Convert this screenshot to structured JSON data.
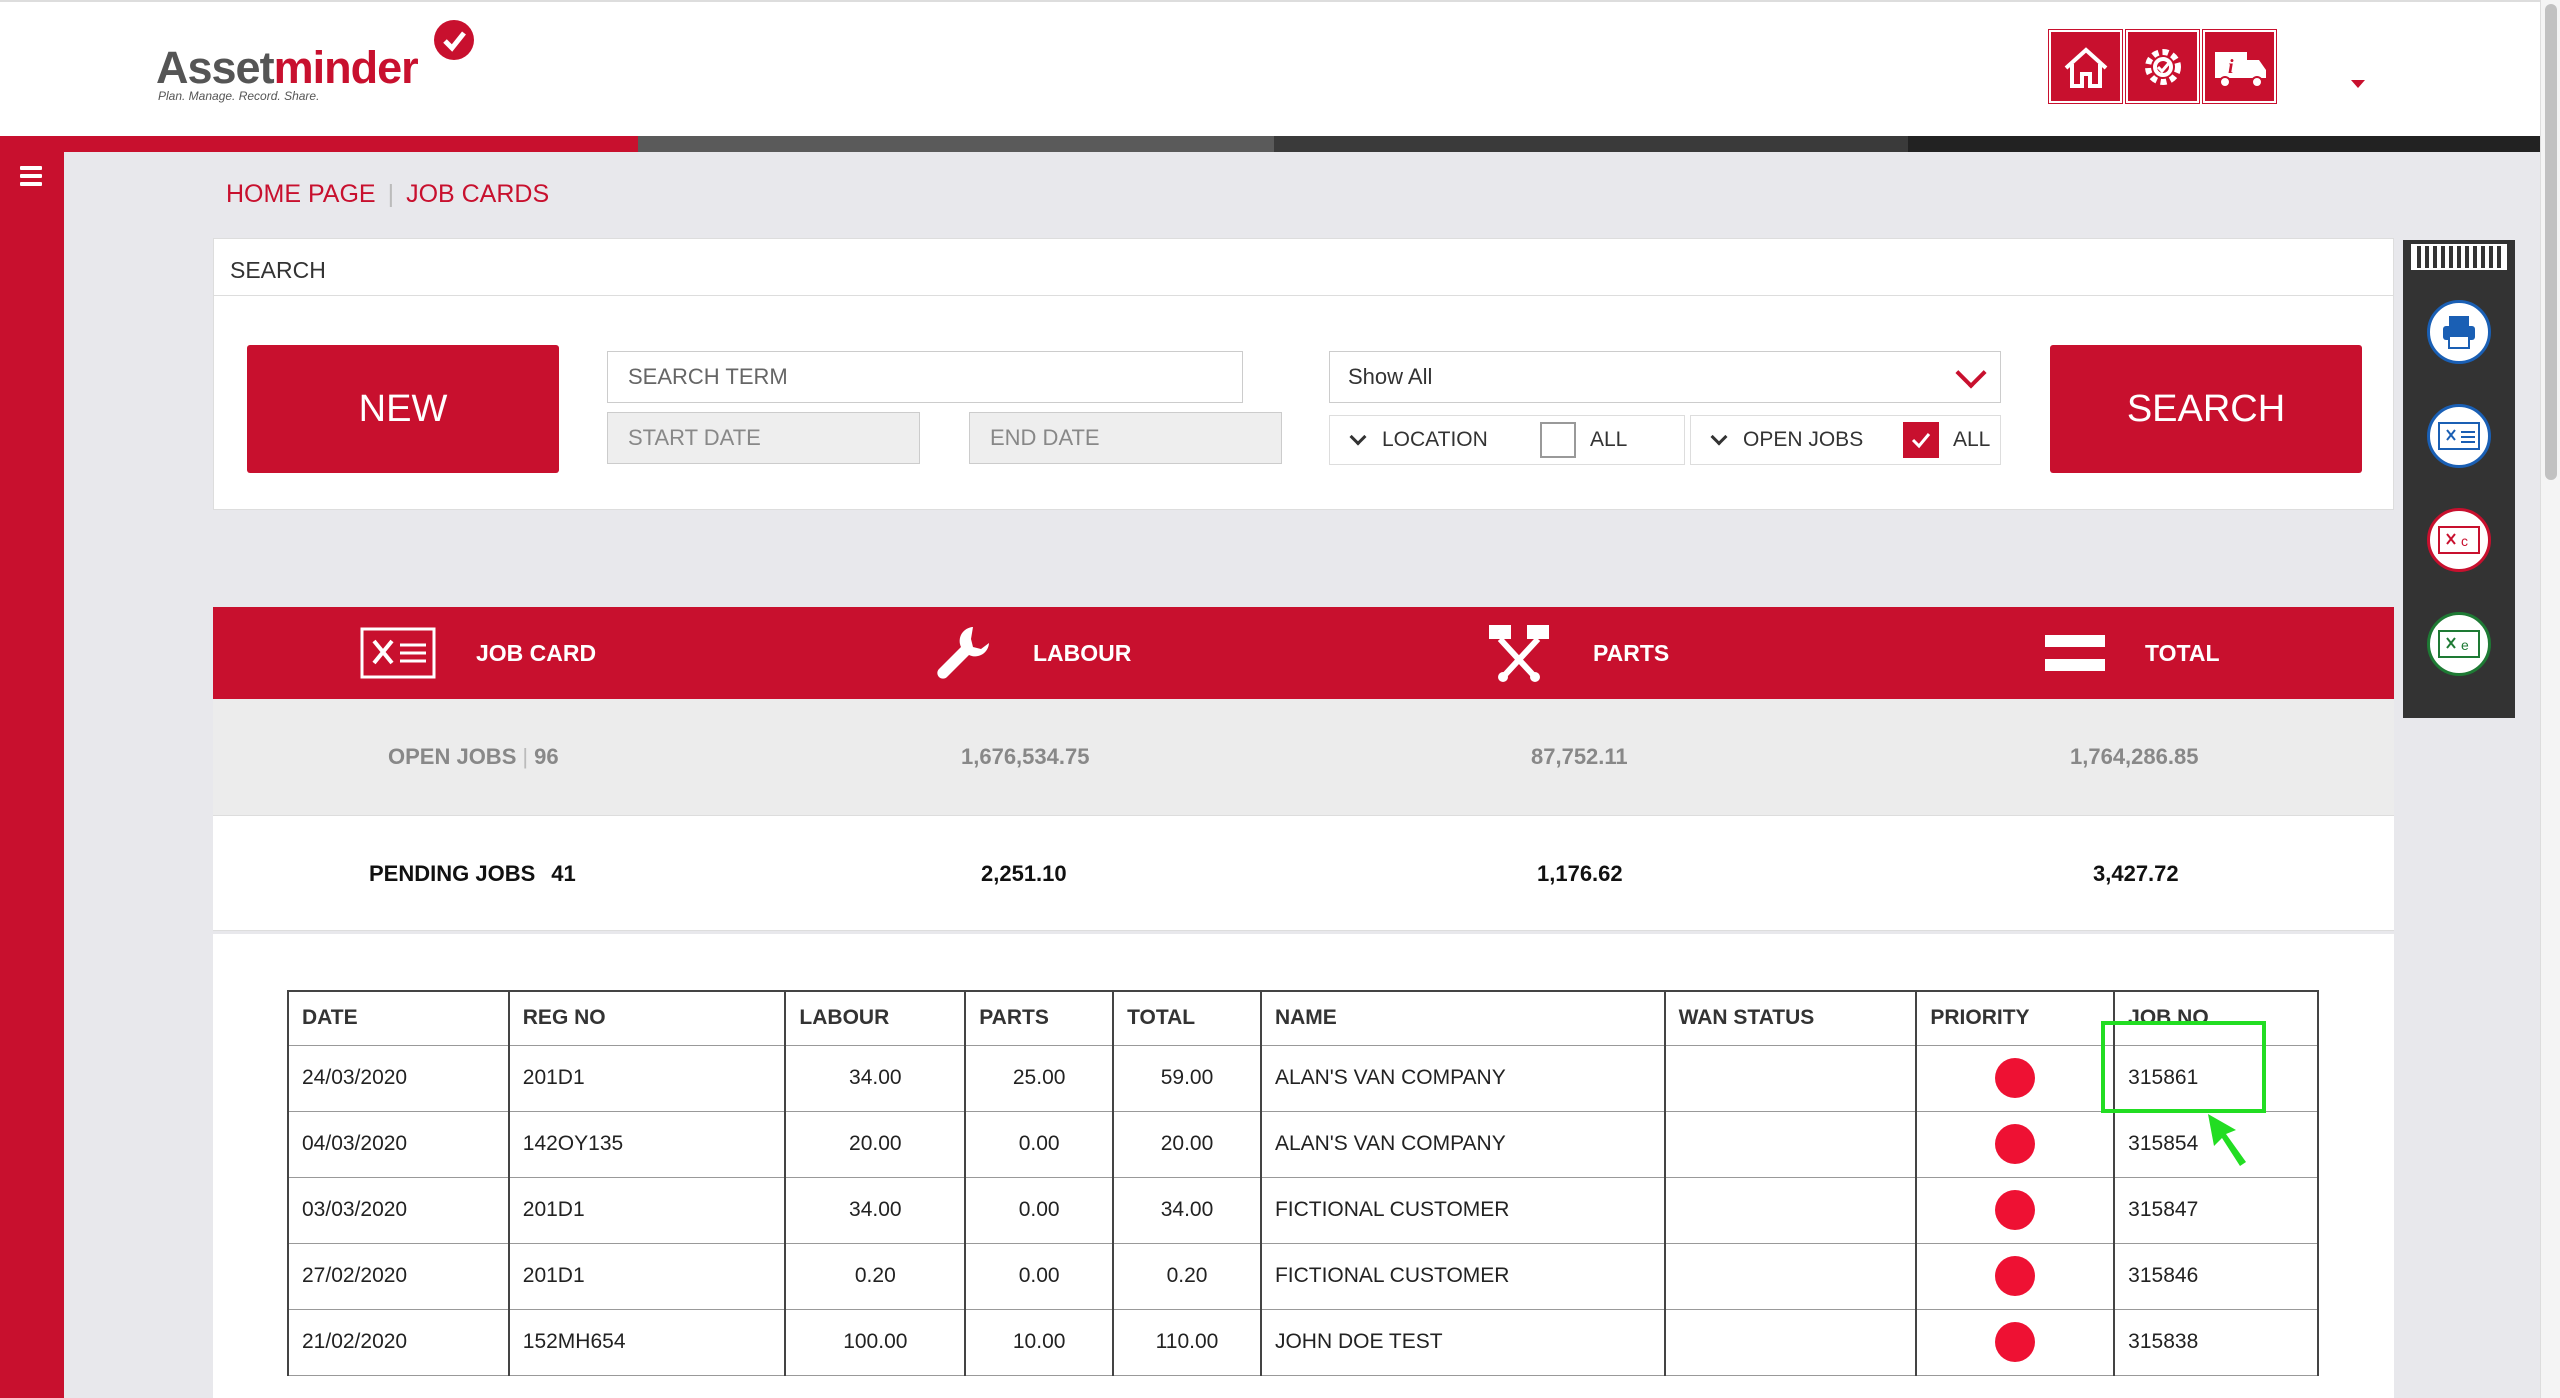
{
  "brand": {
    "name_part1": "Asset",
    "name_part2": "minder",
    "tagline": "Plan. Manage. Record. Share."
  },
  "header": {
    "icons": [
      "home-icon",
      "settings-gear-icon",
      "van-info-icon"
    ],
    "user_menu": "caret-down-icon"
  },
  "breadcrumb": {
    "home": "HOME PAGE",
    "current": "JOB CARDS"
  },
  "search": {
    "title": "SEARCH",
    "new_label": "NEW",
    "search_term_placeholder": "SEARCH TERM",
    "start_date_placeholder": "START DATE",
    "end_date_placeholder": "END DATE",
    "show_select": "Show All",
    "location_label": "LOCATION",
    "location_all_label": "ALL",
    "location_all_checked": false,
    "open_jobs_label": "OPEN JOBS",
    "open_jobs_all_label": "ALL",
    "open_jobs_all_checked": true,
    "search_label": "SEARCH"
  },
  "side_tools": [
    "barcode-icon",
    "print-icon",
    "export-icon",
    "export-csv-icon",
    "export-excel-icon"
  ],
  "summary": {
    "headers": {
      "job_card": "JOB CARD",
      "labour": "LABOUR",
      "parts": "PARTS",
      "total": "TOTAL"
    },
    "open": {
      "label": "OPEN JOBS",
      "count": "96",
      "labour": "1,676,534.75",
      "parts": "87,752.11",
      "total": "1,764,286.85"
    },
    "pending": {
      "label": "PENDING JOBS",
      "count": "41",
      "labour": "2,251.10",
      "parts": "1,176.62",
      "total": "3,427.72"
    }
  },
  "table": {
    "columns": [
      "DATE",
      "REG NO",
      "LABOUR",
      "PARTS",
      "TOTAL",
      "NAME",
      "WAN STATUS",
      "PRIORITY",
      "JOB NO"
    ],
    "rows": [
      {
        "date": "24/03/2020",
        "reg": "201D1",
        "labour": "34.00",
        "parts": "25.00",
        "total": "59.00",
        "name": "ALAN'S VAN COMPANY",
        "wan": "",
        "priority": "#ee1133",
        "job": "315861"
      },
      {
        "date": "04/03/2020",
        "reg": "142OY135",
        "labour": "20.00",
        "parts": "0.00",
        "total": "20.00",
        "name": "ALAN'S VAN COMPANY",
        "wan": "",
        "priority": "#ee1133",
        "job": "315854"
      },
      {
        "date": "03/03/2020",
        "reg": "201D1",
        "labour": "34.00",
        "parts": "0.00",
        "total": "34.00",
        "name": "FICTIONAL CUSTOMER",
        "wan": "",
        "priority": "#ee1133",
        "job": "315847"
      },
      {
        "date": "27/02/2020",
        "reg": "201D1",
        "labour": "0.20",
        "parts": "0.00",
        "total": "0.20",
        "name": "FICTIONAL CUSTOMER",
        "wan": "",
        "priority": "#ee1133",
        "job": "315846"
      },
      {
        "date": "21/02/2020",
        "reg": "152MH654",
        "labour": "100.00",
        "parts": "10.00",
        "total": "110.00",
        "name": "JOHN DOE TEST",
        "wan": "",
        "priority": "#ee1133",
        "job": "315838"
      }
    ]
  },
  "colors": {
    "brand_red": "#c8102e",
    "highlight_green": "#22dd22"
  }
}
